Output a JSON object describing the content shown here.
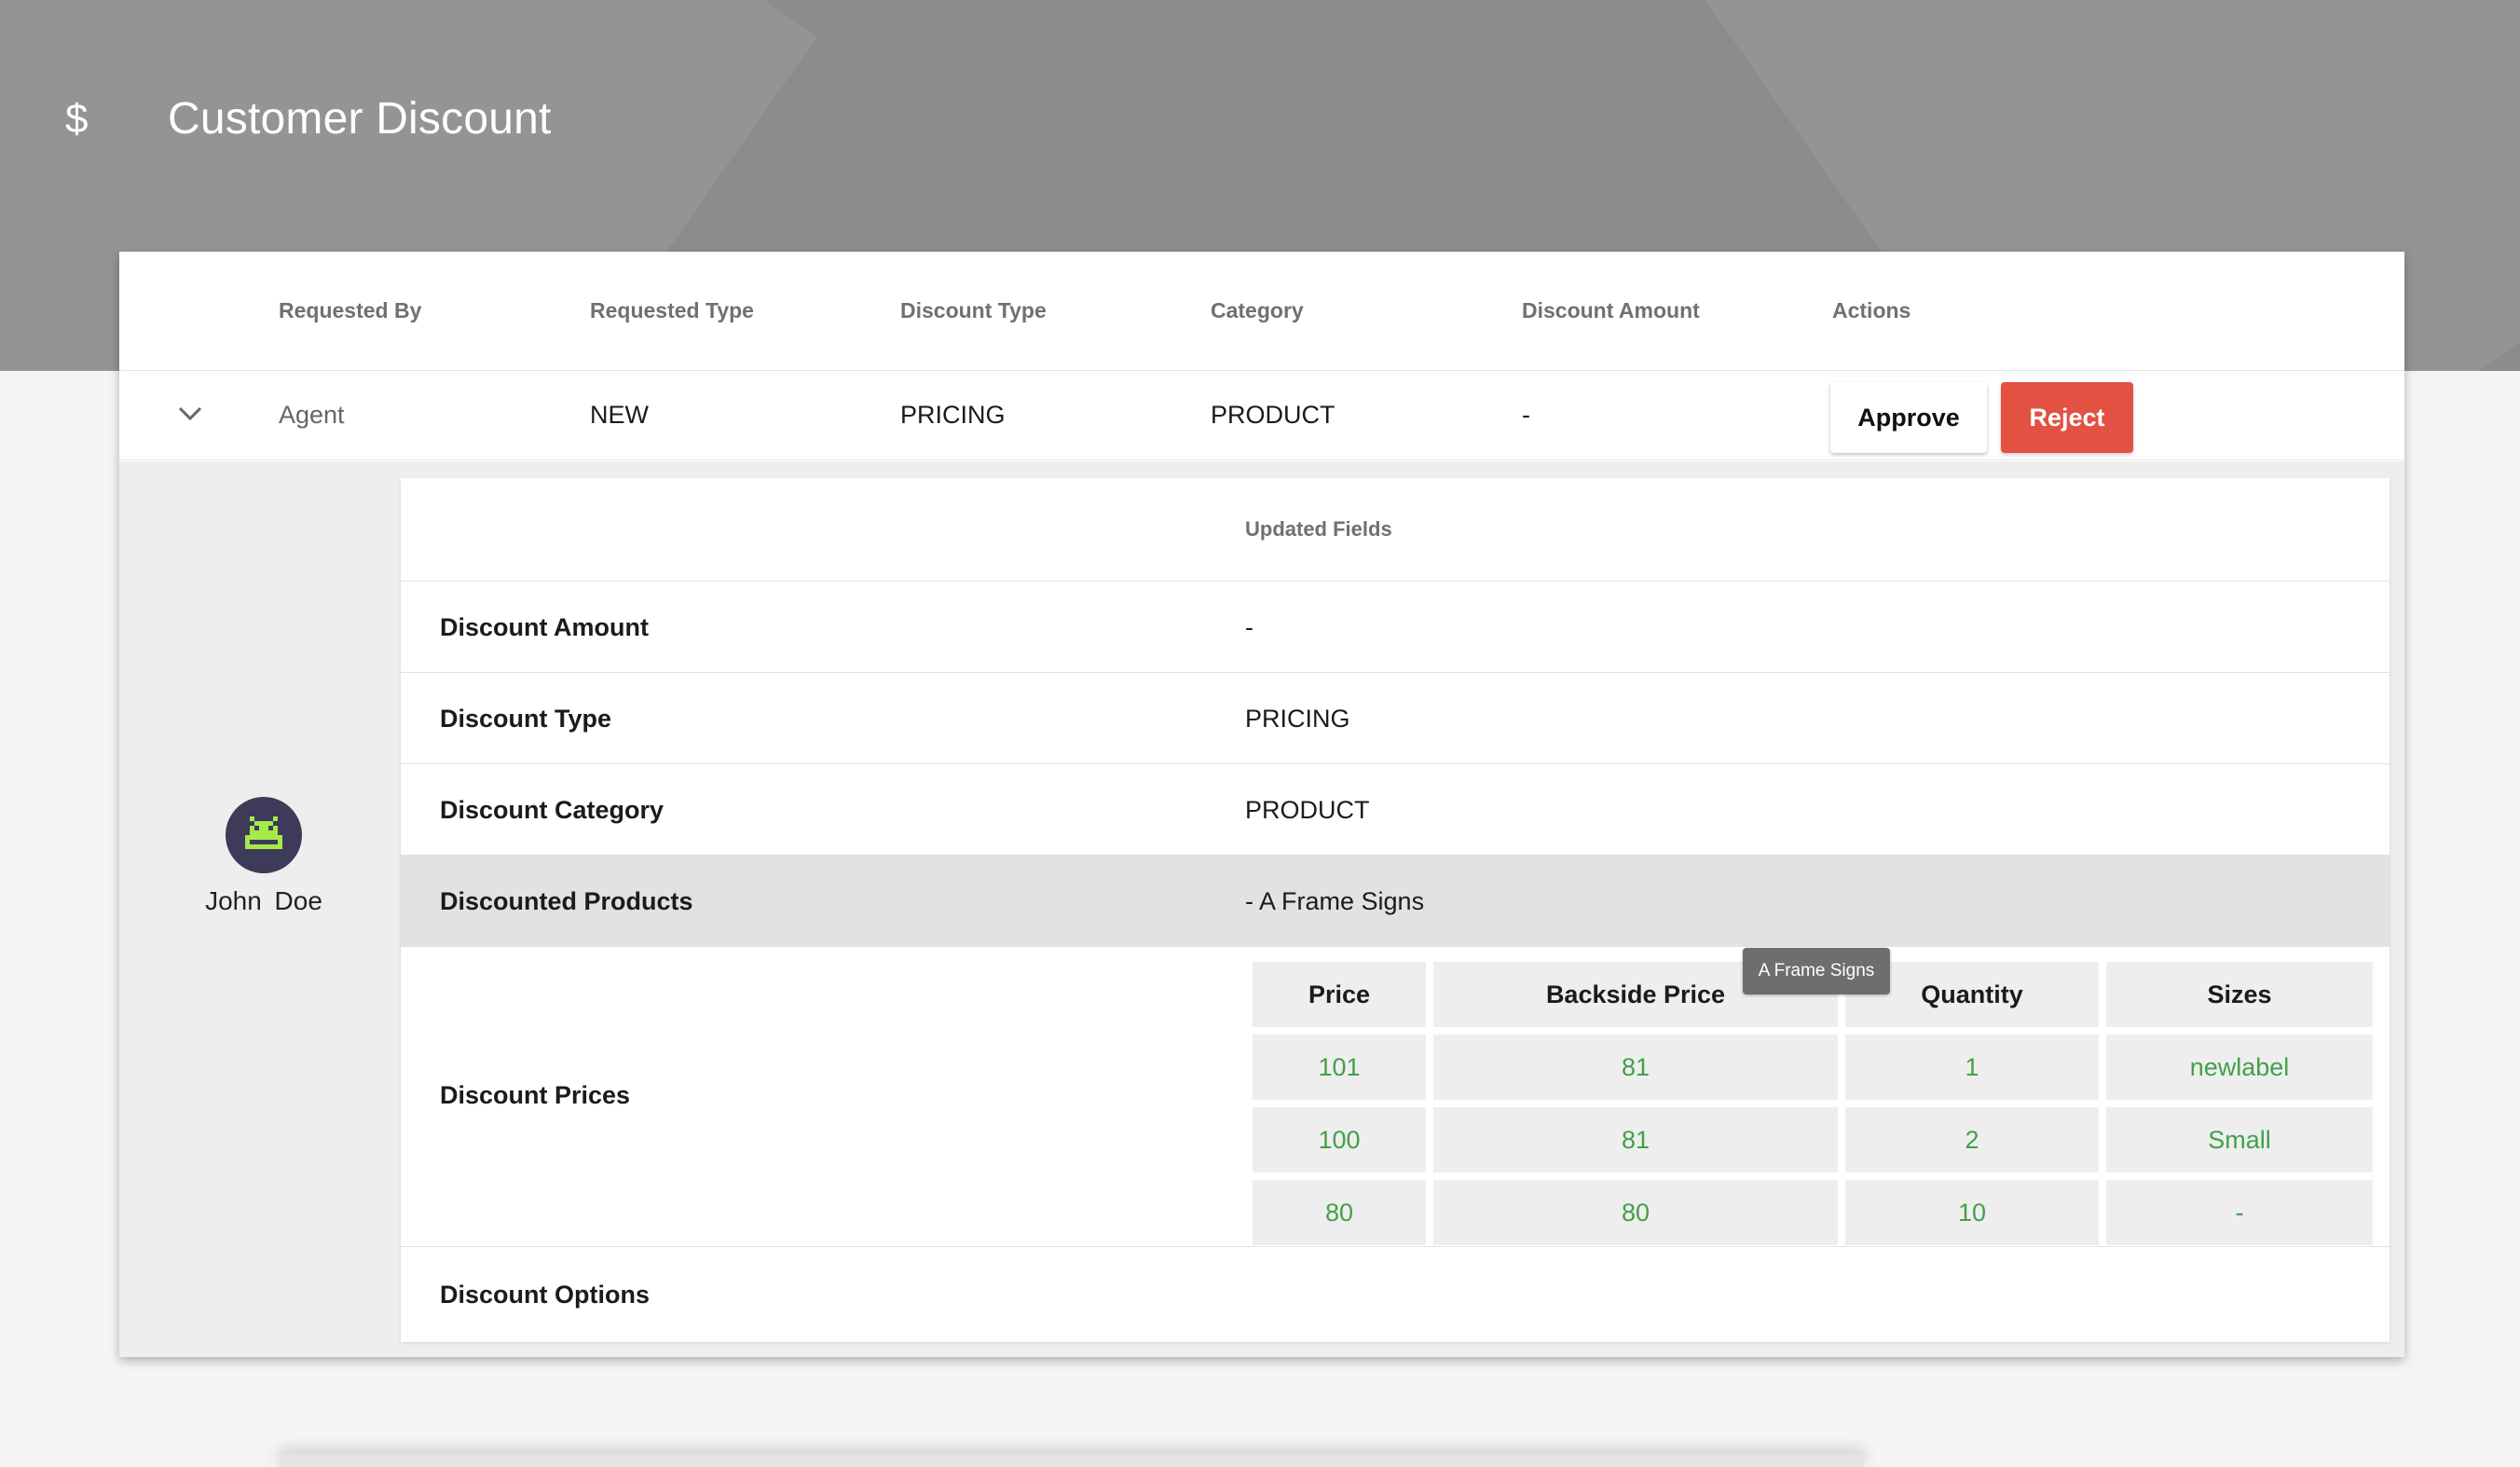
{
  "header": {
    "icon": "dollar-icon",
    "icon_glyph": "$",
    "title": "Customer Discount"
  },
  "table": {
    "columns": [
      "Requested By",
      "Requested Type",
      "Discount Type",
      "Category",
      "Discount Amount",
      "Actions"
    ],
    "row": {
      "requested_by": "Agent",
      "requested_type": "NEW",
      "discount_type": "PRICING",
      "category": "PRODUCT",
      "discount_amount": "-"
    },
    "approve_label": "Approve",
    "reject_label": "Reject"
  },
  "user": {
    "name": "John  Doe"
  },
  "details": {
    "header": "Updated Fields",
    "rows": [
      {
        "label": "Discount Amount",
        "value": "-"
      },
      {
        "label": "Discount Type",
        "value": "PRICING"
      },
      {
        "label": "Discount Category",
        "value": "PRODUCT"
      },
      {
        "label": "Discounted Products",
        "value": "- A Frame Signs"
      },
      {
        "label": "Discount Prices",
        "value": ""
      },
      {
        "label": "Discount Options",
        "value": ""
      }
    ],
    "prices": {
      "columns": [
        "Price",
        "Backside Price",
        "Quantity",
        "Sizes"
      ],
      "rows": [
        [
          "101",
          "81",
          "1",
          "newlabel"
        ],
        [
          "100",
          "81",
          "2",
          "Small"
        ],
        [
          "80",
          "80",
          "10",
          "-"
        ]
      ]
    }
  },
  "tooltip": "A Frame Signs",
  "colors": {
    "header_bg": "#8c8c8c",
    "reject": "#e25141",
    "price_text": "#43a047",
    "avatar_bg": "#3e3a5a",
    "avatar_fg": "#a6e94b"
  }
}
